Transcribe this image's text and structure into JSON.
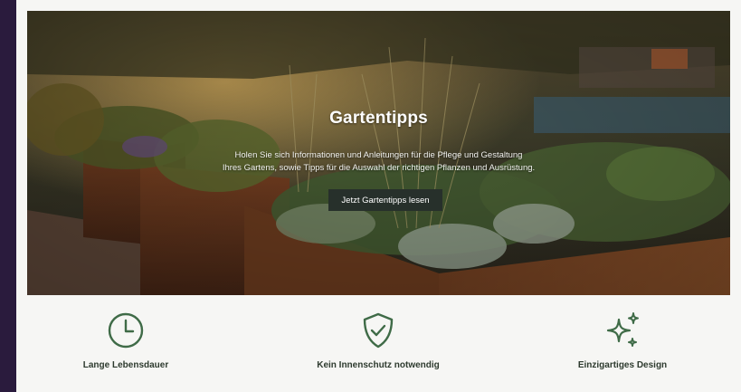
{
  "hero": {
    "title": "Gartentipps",
    "description_line1": "Holen Sie sich Informationen und Anleitungen für die Pflege und Gestaltung",
    "description_line2": "Ihres Gartens, sowie Tipps für die Auswahl der richtigen Pflanzen und Ausrüstung.",
    "button_label": "Jetzt Gartentipps lesen",
    "background": "garden-raised-beds-photo"
  },
  "features": [
    {
      "icon": "clock-icon",
      "label": "Lange Lebensdauer"
    },
    {
      "icon": "shield-check-icon",
      "label": "Kein Innenschutz notwendig"
    },
    {
      "icon": "sparkles-icon",
      "label": "Einzigartiges Design"
    }
  ],
  "colors": {
    "accent": "#3f6b47",
    "button_bg": "#27302b",
    "frame": "#2a1b3d",
    "page_bg": "#f6f6f4"
  }
}
